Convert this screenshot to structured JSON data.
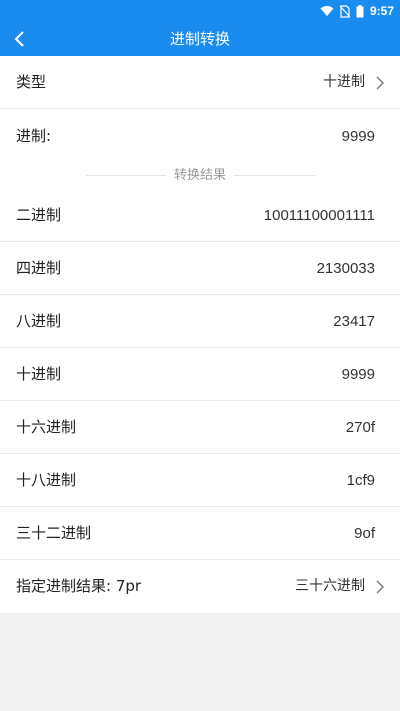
{
  "status_bar": {
    "time": "9:57"
  },
  "app_bar": {
    "title": "进制转换"
  },
  "type_row": {
    "label": "类型",
    "value": "十进制"
  },
  "input_row": {
    "label": "进制:",
    "value": "9999"
  },
  "section_header": "转换结果",
  "results": [
    {
      "label": "二进制",
      "value": "10011100001111"
    },
    {
      "label": "四进制",
      "value": "2130033"
    },
    {
      "label": "八进制",
      "value": "23417"
    },
    {
      "label": "十进制",
      "value": "9999"
    },
    {
      "label": "十六进制",
      "value": "270f"
    },
    {
      "label": "十八进制",
      "value": "1cf9"
    },
    {
      "label": "三十二进制",
      "value": "9of"
    }
  ],
  "custom_row": {
    "label": "指定进制结果:  7pr",
    "value": "三十六进制"
  },
  "colors": {
    "primary": "#1a8cf0",
    "background": "#f0f0f0",
    "divider": "#ececec"
  }
}
